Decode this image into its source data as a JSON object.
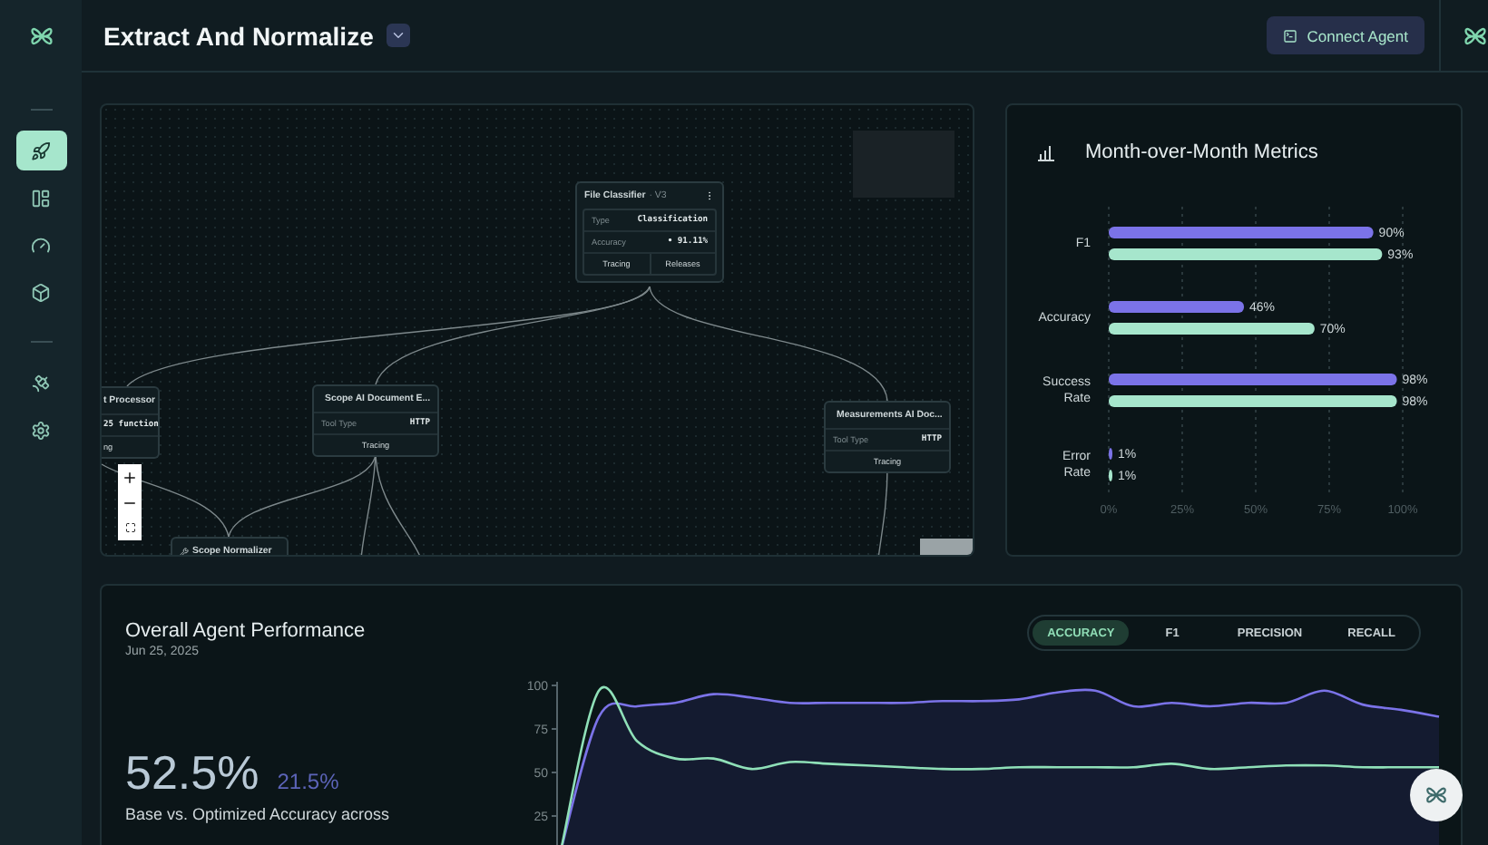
{
  "header": {
    "title": "Extract And Normalize",
    "connect_button": "Connect Agent"
  },
  "sidebar": {
    "groups": [
      [
        {
          "selected": true
        },
        {
          "selected": false
        },
        {
          "selected": false
        },
        {
          "selected": false
        }
      ],
      [
        {
          "selected": false
        },
        {
          "selected": false
        }
      ]
    ]
  },
  "canvas": {
    "nodes": [
      {
        "kind": "model",
        "title": "File Classifier",
        "version": "· V3",
        "rows": [
          {
            "label": "Type",
            "value": "Classification"
          },
          {
            "label": "Accuracy",
            "value": "• 91.11%"
          }
        ],
        "actions": [
          "Tracing",
          "Releases"
        ]
      },
      {
        "kind": "cut",
        "title": "t Processor",
        "rows": [
          {
            "label": "",
            "value": "25 function"
          }
        ],
        "actions": [
          "ng"
        ]
      },
      {
        "kind": "tool",
        "title": "Scope AI Document E...",
        "rows": [
          {
            "label": "Tool Type",
            "value": "HTTP"
          }
        ],
        "actions": [
          "Tracing"
        ]
      },
      {
        "kind": "tool",
        "title": "Measurements AI Doc...",
        "rows": [
          {
            "label": "Tool Type",
            "value": "HTTP"
          }
        ],
        "actions": [
          "Tracing"
        ]
      },
      {
        "kind": "stub",
        "title": "Scope Normalizer"
      }
    ]
  },
  "metrics": {
    "title": "Month-over-Month Metrics",
    "chart_data": {
      "type": "bar",
      "orientation": "horizontal",
      "categories": [
        "F1",
        "Accuracy",
        "Success Rate",
        "Error Rate"
      ],
      "series": [
        {
          "color": "#7b73e8",
          "values": [
            90,
            46,
            98,
            1
          ]
        },
        {
          "color": "#a6e6cc",
          "values": [
            93,
            70,
            98,
            1
          ]
        }
      ],
      "xlim": [
        0,
        100
      ],
      "xticks": [
        {
          "value": 0,
          "label": "0%"
        },
        {
          "value": 25,
          "label": "25%"
        },
        {
          "value": 50,
          "label": "50%"
        },
        {
          "value": 75,
          "label": "75%"
        },
        {
          "value": 100,
          "label": "100%"
        }
      ],
      "grid": true,
      "value_labels": [
        [
          "90%",
          "46%",
          "98%",
          "1%"
        ],
        [
          "93%",
          "70%",
          "98%",
          "1%"
        ]
      ]
    }
  },
  "performance": {
    "title": "Overall Agent Performance",
    "date": "Jun 25, 2025",
    "value": "52.5%",
    "delta": "21.5%",
    "caption": "Base vs. Optimized Accuracy across",
    "tabs": [
      {
        "label": "ACCURACY",
        "selected": true
      },
      {
        "label": "F1",
        "selected": false
      },
      {
        "label": "PRECISION",
        "selected": false
      },
      {
        "label": "RECALL",
        "selected": false
      }
    ],
    "chart_data": {
      "type": "line",
      "ylim": [
        0,
        100
      ],
      "yticks": [
        25,
        50,
        75,
        100
      ],
      "series": [
        {
          "color": "#7b73e8",
          "values": [
            5,
            82,
            88,
            90,
            95,
            93,
            90,
            90,
            90,
            90,
            91,
            91,
            92,
            96,
            97,
            88,
            90,
            88,
            90,
            90,
            97,
            89,
            86,
            82
          ]
        },
        {
          "color": "#8fe0b8",
          "values": [
            5,
            97,
            68,
            58,
            58,
            52,
            56,
            55,
            54,
            53,
            52,
            52,
            53,
            53,
            53,
            53,
            55,
            52,
            53,
            54,
            54,
            53,
            53,
            53
          ]
        }
      ]
    }
  }
}
